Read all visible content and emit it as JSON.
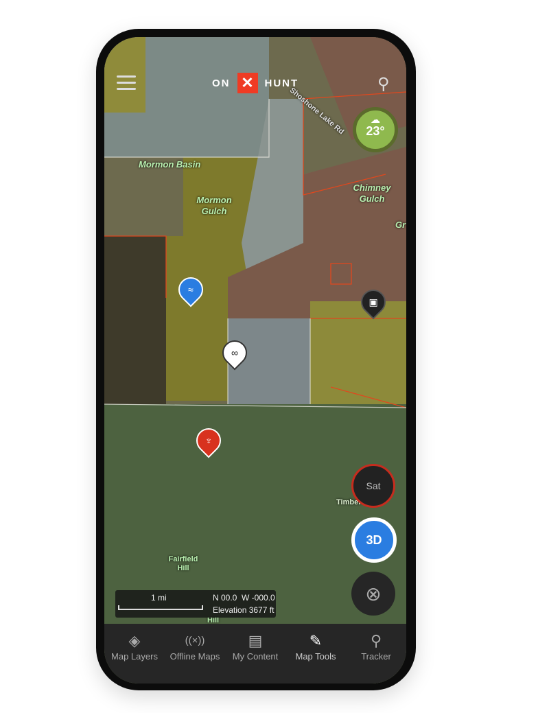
{
  "header": {
    "logo_left": "ON",
    "logo_mark": "✕",
    "logo_right": "HUNT"
  },
  "weather": {
    "icon": "cloud-icon",
    "temperature": "23°"
  },
  "map_labels": {
    "road": "Shoshone Lake Rd",
    "mormon_basin": "Mormon Basin",
    "mormon_gulch": "Mormon Gulch",
    "chimney_gulch": "Chimney Gulch",
    "gr": "Gr",
    "timber": "Timber",
    "fairfield_hill": "Fairfield Hill",
    "hill": "Hill"
  },
  "map_buttons": {
    "sat": "Sat",
    "three_d": "3D"
  },
  "scale": {
    "distance": "1 mi",
    "coords": "N 00.0  W -000.0",
    "elevation": "Elevation 3677 ft"
  },
  "tabs": [
    {
      "label": "Map Layers",
      "icon": "layers-icon"
    },
    {
      "label": "Offline Maps",
      "icon": "offline-icon"
    },
    {
      "label": "My Content",
      "icon": "folder-icon"
    },
    {
      "label": "Map Tools",
      "icon": "tools-icon",
      "active": true
    },
    {
      "label": "Tracker",
      "icon": "tracker-icon"
    }
  ],
  "colors": {
    "accent": "#ef3b24",
    "blue": "#2a7de1",
    "weather": "#8fb94e"
  }
}
